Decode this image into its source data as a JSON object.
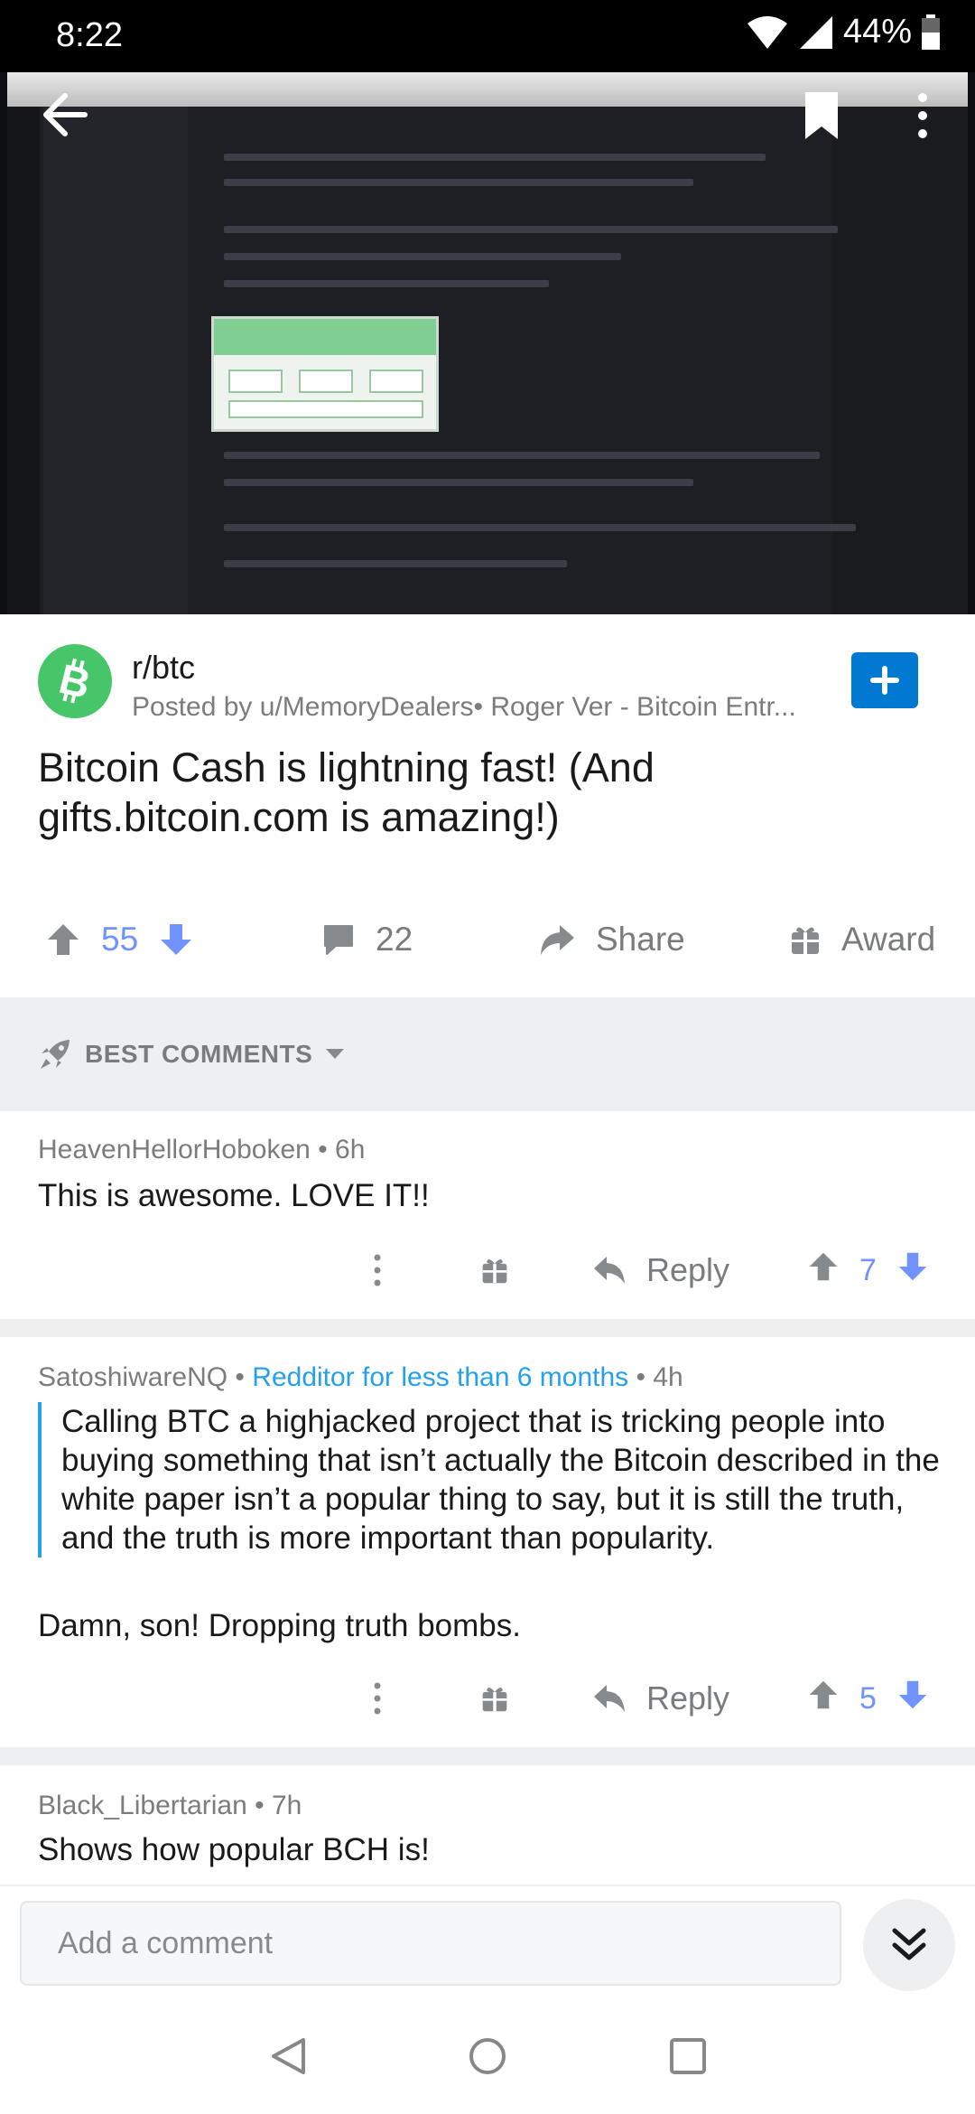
{
  "status": {
    "time": "8:22",
    "battery": "44%"
  },
  "post": {
    "subreddit": "r/btc",
    "meta": "Posted by u/MemoryDealers• Roger Ver - Bitcoin Entr...",
    "title": "Bitcoin Cash is lightning fast! (And gifts.bitcoin.com is amazing!)",
    "score": "55",
    "comments_count": "22",
    "share_label": "Share",
    "award_label": "Award"
  },
  "sort": {
    "label": "BEST COMMENTS"
  },
  "comments": [
    {
      "author": "HeavenHellorHoboken",
      "time": " • 6h",
      "body": "This is awesome. LOVE IT!!",
      "reply_label": "Reply",
      "score": "7"
    },
    {
      "author": "SatoshiwareNQ",
      "flair": "Redditor for less than 6 months",
      "time": " • 4h",
      "sep": " • ",
      "quote": "Calling BTC a highjacked project that is tricking people into buying something that isn’t actually the Bitcoin described in the white paper isn’t a popular thing to say, but it is still the truth, and the truth is more important than popularity.",
      "body": "Damn, son! Dropping truth bombs.",
      "reply_label": "Reply",
      "score": "5"
    },
    {
      "author": "Black_Libertarian",
      "time": " • 7h",
      "body": "Shows how popular BCH is!"
    }
  ],
  "composer": {
    "placeholder": "Add a comment"
  },
  "colors": {
    "upvote_grey": "#878a8c",
    "vote_blue": "#7193ff",
    "flair_blue": "#24a0ed",
    "join_blue": "#0079d3",
    "subreddit_green": "#46c669"
  },
  "icons": {
    "back": "arrow-left-icon",
    "save": "bookmark-icon",
    "more": "kebab-icon",
    "upvote": "arrow-up-icon",
    "downvote": "arrow-down-icon",
    "comment": "speech-bubble-icon",
    "share": "share-arrow-icon",
    "award": "gift-icon",
    "sort": "rocket-icon",
    "reply": "reply-arrow-icon",
    "collapse": "double-chevron-down-icon"
  }
}
